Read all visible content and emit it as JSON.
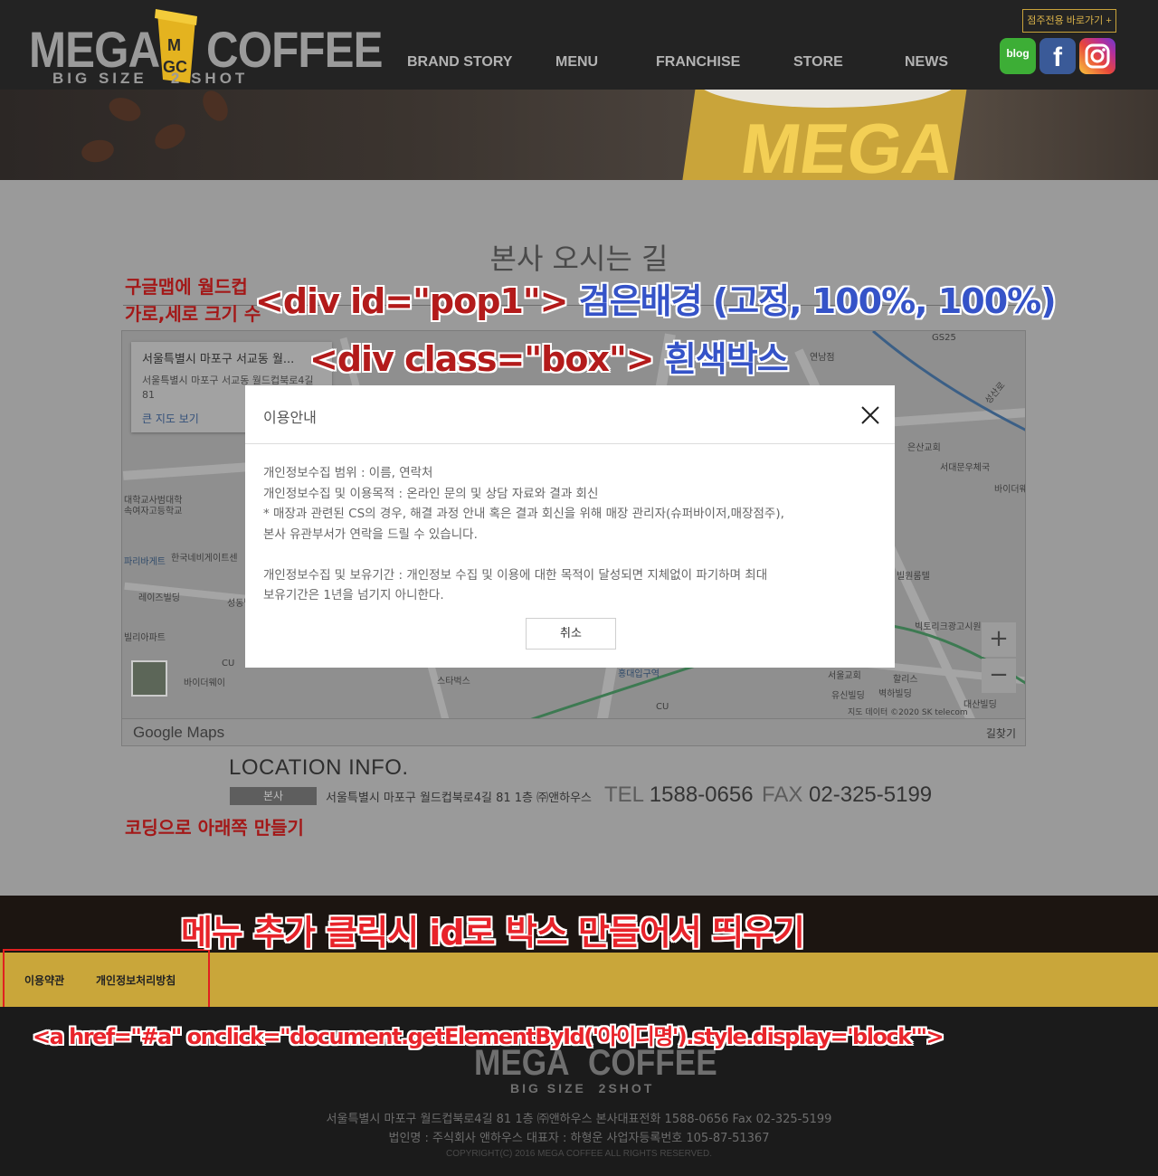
{
  "header": {
    "logo": {
      "word_left": "MEGA",
      "word_right": "COFFEE",
      "badge": "MGC",
      "tagline": "BIG SIZE   2 SHOT"
    },
    "nav": [
      "BRAND STORY",
      "MENU",
      "FRANCHISE",
      "STORE",
      "NEWS"
    ],
    "store_link": "점주전용 바로가기 +",
    "sns": [
      {
        "name": "blog",
        "label": "blog",
        "icon": "blog-icon"
      },
      {
        "name": "facebook",
        "label": "f",
        "icon": "facebook-icon"
      },
      {
        "name": "instagram",
        "label": "",
        "icon": "instagram-icon"
      }
    ]
  },
  "banner": {
    "cup_text": "MEGA"
  },
  "content": {
    "title": "본사 오시는 길",
    "map": {
      "place_title": "서울특별시 마포구 서교동 월...",
      "place_address": "서울특별시 마포구 서교동 월드컵북로4길 81",
      "directions_short": "길찾기",
      "larger_map": "큰 지도 보기",
      "brand": "Google Maps",
      "directions": "길찾기",
      "zoom_in": "+",
      "zoom_out": "−",
      "copyright": "지도 데이터 ©2020 SK telecom",
      "labels": [
        "GS25",
        "연남점",
        "성산로",
        "은산교회",
        "서대문우체국",
        "바이더웨",
        "대학교사범대학",
        "속여자고등학교",
        "파리바게트",
        "한국네비게이트센",
        "레이즈빌딩",
        "성동빌딩",
        "빌리아파트",
        "CU",
        "바이더웨이",
        "스타벅스",
        "홍대입구역",
        "서울교회",
        "유신빌딩",
        "벽하빌딩",
        "할리스",
        "빅토리크광고시원",
        "빌원룸텔",
        "대산빌딩",
        "CU"
      ]
    },
    "location": {
      "title": "LOCATION INFO.",
      "badge": "본사",
      "address": "서울특별시 마포구 월드컵북로4길 81 1층 ㈜앤하우스",
      "tel_label": "TEL",
      "tel": "1588-0656",
      "fax_label": "FAX",
      "fax": "02-325-5199"
    }
  },
  "annotations": {
    "maps_note_1": "구글맵에 월드컵",
    "maps_note_2": "가로,세로 크기 수",
    "pop_prefix": "<div id=\"pop1\">",
    "pop_desc": "검은배경 (고정, 100%, 100%)",
    "box_prefix": "<div class=\"box\">",
    "box_desc": "흰색박스",
    "coding_note": "코딩으로 아래쪽 만들기",
    "menu_note": "메뉴 추가 클릭시 id로 박스 만들어서 띄우기",
    "code_note": "<a href=\"#a\" onclick=\"document.getElementById('아이디명').style.display='block'\">"
  },
  "footer": {
    "links": [
      "이용약관",
      "개인정보처리방침"
    ],
    "logo": {
      "word_left": "MEGA",
      "word_right": "COFFEE",
      "tagline": "BIG SIZE  2SHOT"
    },
    "info_line1": "서울특별시 마포구 월드컵북로4길 81 1층 ㈜앤하우스     본사대표전화  1588-0656     Fax  02-325-5199",
    "info_line2": "법인명 : 주식회사 앤하우스     대표자 : 하형운     사업자등록번호 105-87-51367",
    "copyright": "COPYRIGHT(C) 2016 MEGA COFFEE ALL RIGHTS RESERVED."
  },
  "popup": {
    "title": "이용안내",
    "lines": [
      "개인정보수집 범위 : 이름, 연락처",
      "개인정보수집 및 이용목적 : 온라인 문의 및 상담 자료와 결과 회신",
      "* 매장과 관련된 CS의 경우, 해결 과정 안내 혹은 결과 회신을 위해 매장 관리자(슈퍼바이저,매장점주),",
      "본사 유관부서가 연락을 드릴 수 있습니다.",
      "",
      "개인정보수집 및 보유기간 : 개인정보 수집 및 이용에 대한 목적이 달성되면 지체없이 파기하며 최대",
      "보유기간은 1년을 넘기지 아니한다."
    ],
    "cancel": "취소"
  },
  "colors": {
    "brand_yellow": "#c9a63a",
    "annotation_blue": "#3553c8",
    "annotation_red": "#e8232a"
  }
}
